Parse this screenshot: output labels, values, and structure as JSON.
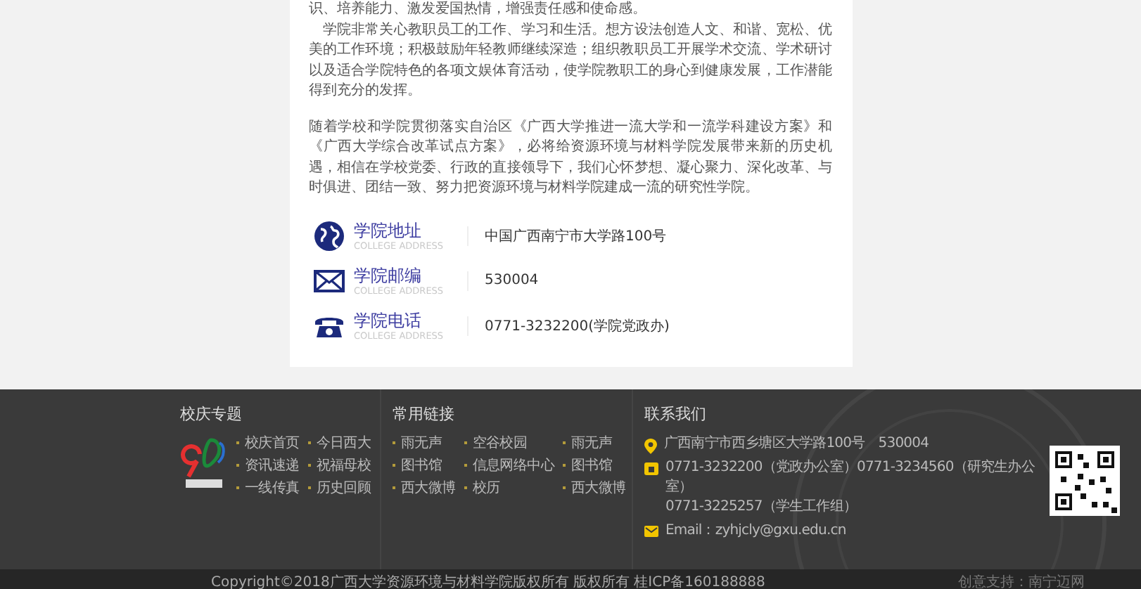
{
  "intro": {
    "blocks": [
      {
        "paragraphs": [
          {
            "text": "识、培养能力、激发爱国热情，增强责任感和使命感。",
            "indent": false
          },
          {
            "text": "学院非常关心教职员工的工作、学习和生活。想方设法创造人文、和谐、宽松、优美的工作环境；积极鼓励年轻教师继续深造；组织教职员工开展学术交流、学术研讨以及适合学院特色的各项文娱体育活动，使学院教职工的身心到健康发展，工作潜能得到充分的发挥。",
            "indent": true
          }
        ]
      },
      {
        "paragraphs": [
          {
            "text": "随着学校和学院贯彻落实自治区《广西大学推进一流大学和一流学科建设方案》和《广西大学综合改革试点方案》，必将给资源环境与材料学院发展带来新的历史机遇，相信在学校党委、行政的直接领导下，我们心怀梦想、凝心聚力、深化改革、与时俱进、团结一致、努力把资源环境与材料学院建成一流的研究性学院。",
            "indent": false
          }
        ]
      }
    ]
  },
  "contacts": [
    {
      "kind": "address",
      "label": "学院地址",
      "sublabel": "COLLEGE ADDRESS",
      "value": "中国广西南宁市大学路100号"
    },
    {
      "kind": "postcode",
      "label": "学院邮编",
      "sublabel": "COLLEGE ADDRESS",
      "value": "530004"
    },
    {
      "kind": "phone",
      "label": "学院电话",
      "sublabel": "COLLEGE ADDRESS",
      "value": "0771-3232200(学院党政办)"
    }
  ],
  "footer": {
    "anniversary": {
      "title": "校庆专题",
      "links": [
        "校庆首页",
        "今日西大",
        "资讯速递",
        "祝福母校",
        "一线传真",
        "历史回顾"
      ]
    },
    "links": {
      "title": "常用链接",
      "items": [
        "雨无声",
        "空谷校园",
        "雨无声",
        "图书馆",
        "信息网络中心",
        "图书馆",
        "西大微博",
        "校历",
        "西大微博"
      ]
    },
    "contact": {
      "title": "联系我们",
      "items": [
        {
          "kind": "address",
          "lines": [
            "广西南宁市西乡塘区大学路100号　530004"
          ]
        },
        {
          "kind": "phone",
          "lines": [
            "0771-3232200（党政办公室）0771-3234560（研究生办公室）",
            "0771-3225257（学生工作组）"
          ]
        },
        {
          "kind": "email",
          "lines": [
            "Email：zyhjcly@gxu.edu.cn"
          ]
        }
      ]
    }
  },
  "bottom_bar": {
    "copyright": "Copyright©2018广西大学资源环境与材料学院版权所有 版权所有 桂ICP备160188888",
    "credit": "创意支持：南宁迈网"
  }
}
